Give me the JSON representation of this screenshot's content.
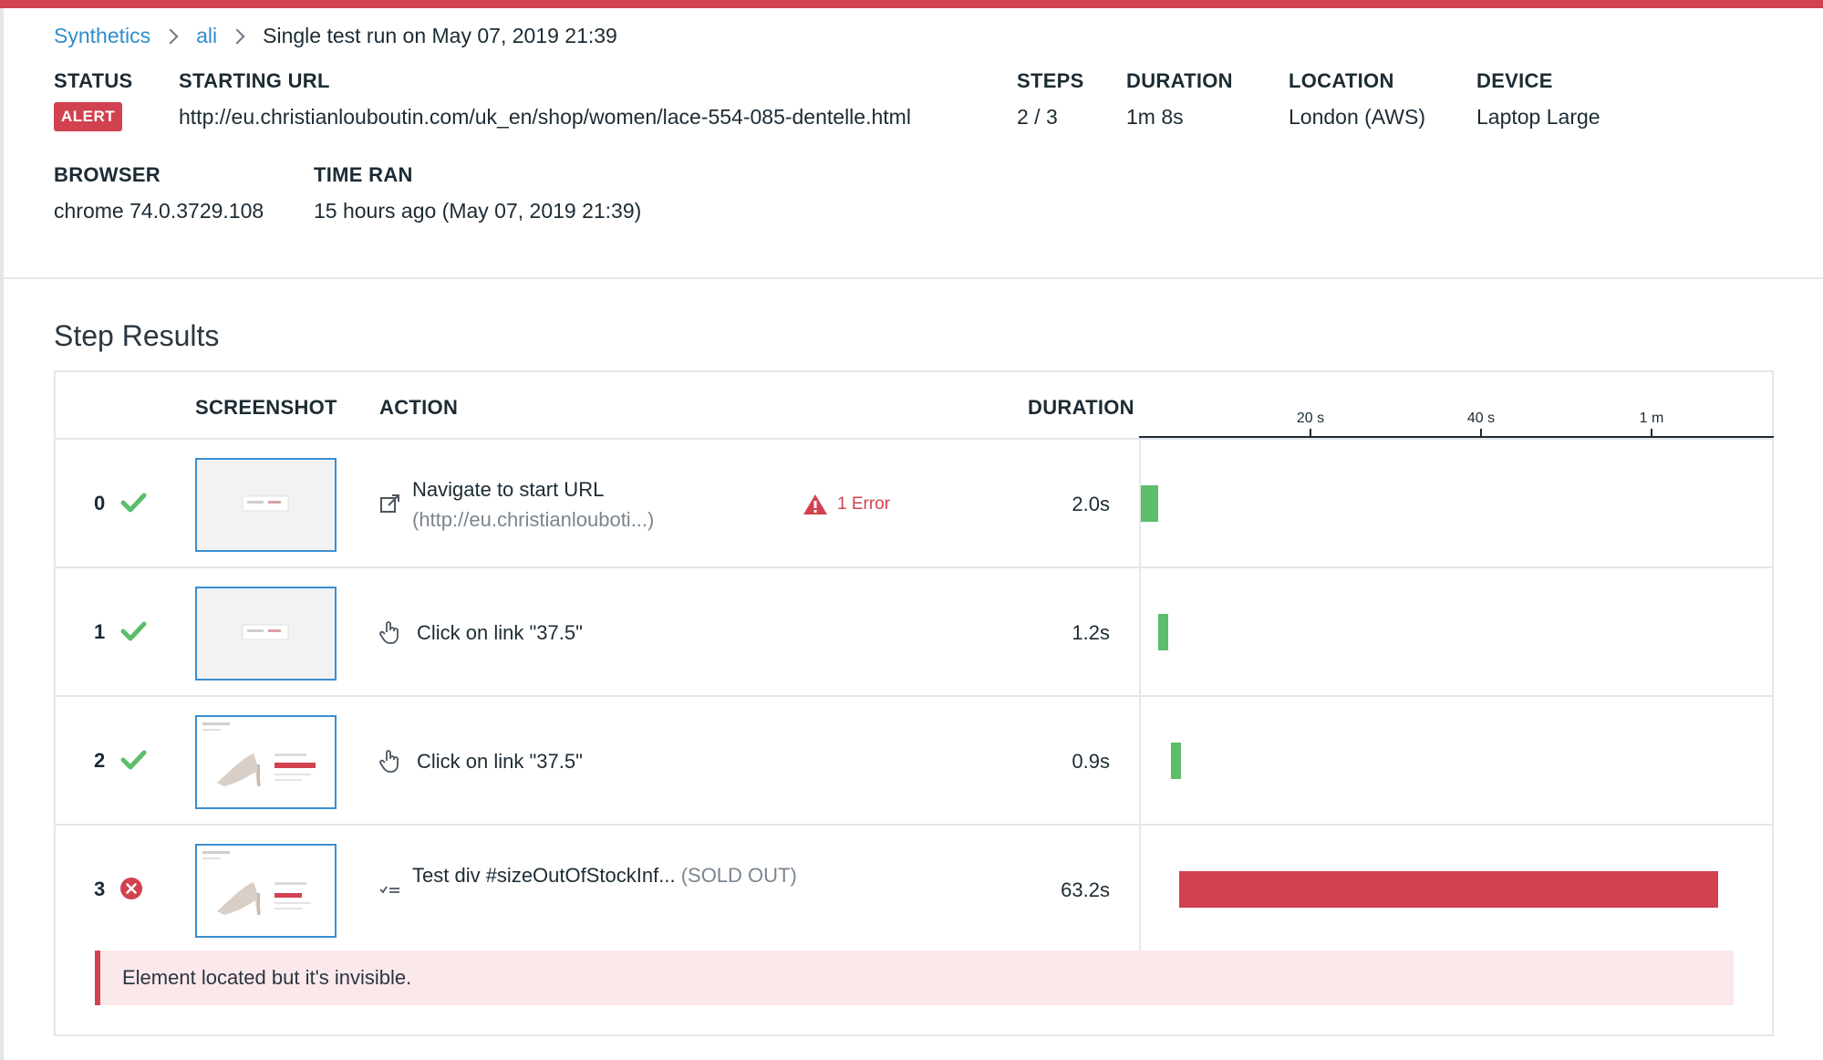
{
  "breadcrumb": {
    "root": "Synthetics",
    "test": "ali",
    "current": "Single test run on May 07, 2019 21:39"
  },
  "meta": {
    "status_label": "STATUS",
    "status_value": "ALERT",
    "starting_url_label": "STARTING URL",
    "starting_url_value": "http://eu.christianlouboutin.com/uk_en/shop/women/lace-554-085-dentelle.html",
    "steps_label": "STEPS",
    "steps_value": "2 / 3",
    "duration_label": "DURATION",
    "duration_value": "1m 8s",
    "location_label": "LOCATION",
    "location_value": "London (AWS)",
    "device_label": "DEVICE",
    "device_value": "Laptop Large",
    "browser_label": "BROWSER",
    "browser_value": "chrome 74.0.3729.108",
    "time_ran_label": "TIME RAN",
    "time_ran_value": "15 hours ago (May 07, 2019 21:39)"
  },
  "step_results": {
    "title": "Step Results",
    "columns": {
      "screenshot": "SCREENSHOT",
      "action": "ACTION",
      "duration": "DURATION"
    },
    "axis_ticks": [
      "20 s",
      "40 s",
      "1 m"
    ],
    "rows": [
      {
        "index": "0",
        "status": "success",
        "icon": "external-link-icon",
        "action": "Navigate to start URL",
        "action_sub": "(http://eu.christianlouboti...)",
        "warning": "1 Error",
        "duration": "2.0s",
        "start_s": 0,
        "duration_s": 2.0
      },
      {
        "index": "1",
        "status": "success",
        "icon": "pointer-hand-icon",
        "action": "Click on link \"37.5\"",
        "action_sub": "",
        "warning": "",
        "duration": "1.2s",
        "start_s": 2.0,
        "duration_s": 1.2
      },
      {
        "index": "2",
        "status": "success",
        "icon": "pointer-hand-icon",
        "action": "Click on link \"37.5\"",
        "action_sub": "",
        "warning": "",
        "duration": "0.9s",
        "start_s": 3.5,
        "duration_s": 0.9
      },
      {
        "index": "3",
        "status": "error",
        "icon": "assertion-icon",
        "action": "Test div #sizeOutOfStockInf...",
        "action_sub": "(SOLD OUT)",
        "warning": "",
        "duration": "63.2s",
        "start_s": 4.5,
        "duration_s": 63.2,
        "error_message": "Element located but it's invisible."
      }
    ]
  },
  "colors": {
    "accent_red": "#d1414f",
    "success_green": "#5cbd6b",
    "link_blue": "#2f8dcb"
  }
}
